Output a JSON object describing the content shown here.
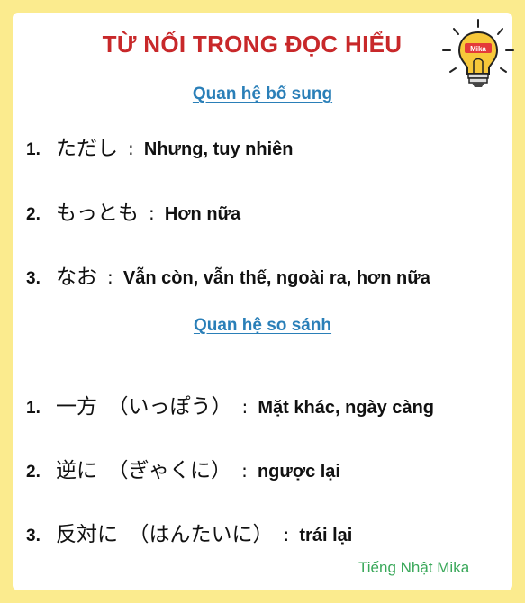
{
  "title": "TỪ NỐI TRONG ĐỌC HIỂU",
  "sections": [
    {
      "heading": "Quan hệ bổ sung",
      "items": [
        {
          "number": "1.",
          "jp": "ただし",
          "sep": ":",
          "meaning": "Nhưng, tuy nhiên"
        },
        {
          "number": "2.",
          "jp": "もっとも",
          "sep": ":",
          "meaning": "Hơn nữa"
        },
        {
          "number": "3.",
          "jp": "なお",
          "sep": ":",
          "meaning": "Vẫn còn, vẫn thế, ngoài ra, hơn nữa"
        }
      ]
    },
    {
      "heading": "Quan hệ so sánh",
      "items": [
        {
          "number": "1.",
          "jp": "一方　（いっぽう）",
          "sep": ":",
          "meaning": "Mặt khác, ngày càng"
        },
        {
          "number": "2.",
          "jp": "逆に　（ぎゃくに）",
          "sep": ":",
          "meaning": "ngược lại"
        },
        {
          "number": "3.",
          "jp": "反対に　（はんたいに）",
          "sep": ":",
          "meaning": "trái lại"
        }
      ]
    }
  ],
  "footer": "Tiếng Nhật Mika",
  "logo_text": "Mika",
  "colors": {
    "background": "#fbeb8e",
    "title": "#c8282a",
    "heading": "#2a7fb8",
    "footer": "#3aa85a",
    "bulb": "#f7c83a"
  },
  "icons": [
    "lightbulb-icon"
  ]
}
